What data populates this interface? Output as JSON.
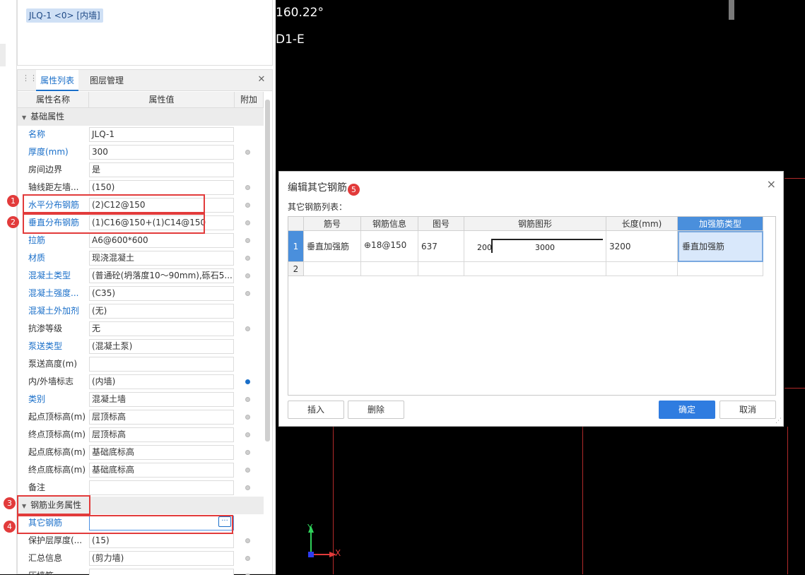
{
  "top_panel": {
    "wall_tag": "JLQ-1 <0> [内墙]"
  },
  "tabs": [
    {
      "label": "属性列表"
    },
    {
      "label": "图层管理"
    }
  ],
  "table_header": {
    "name": "属性名称",
    "value": "属性值",
    "extra": "附加"
  },
  "groups": [
    {
      "label": "基础属性"
    },
    {
      "label": "钢筋业务属性"
    }
  ],
  "props": [
    {
      "name": "名称",
      "value": "JLQ-1"
    },
    {
      "name": "厚度(mm)",
      "value": "300"
    },
    {
      "name": "房间边界",
      "value": "是"
    },
    {
      "name": "轴线距左墙...",
      "value": "(150)"
    },
    {
      "name": "水平分布钢筋",
      "value": "(2)C12@150"
    },
    {
      "name": "垂直分布钢筋",
      "value": "(1)C16@150+(1)C14@150"
    },
    {
      "name": "拉筋",
      "value": "A6@600*600"
    },
    {
      "name": "材质",
      "value": "现浇混凝土"
    },
    {
      "name": "混凝土类型",
      "value": "(普通砼(坍落度10～90mm),砾石5..."
    },
    {
      "name": "混凝土强度...",
      "value": "(C35)"
    },
    {
      "name": "混凝土外加剂",
      "value": "(无)"
    },
    {
      "name": "抗渗等级",
      "value": "无"
    },
    {
      "name": "泵送类型",
      "value": "(混凝土泵)"
    },
    {
      "name": "泵送高度(m)",
      "value": ""
    },
    {
      "name": "内/外墙标志",
      "value": "(内墙)"
    },
    {
      "name": "类别",
      "value": "混凝土墙"
    },
    {
      "name": "起点顶标高(m)",
      "value": "层顶标高"
    },
    {
      "name": "终点顶标高(m)",
      "value": "层顶标高"
    },
    {
      "name": "起点底标高(m)",
      "value": "基础底标高"
    },
    {
      "name": "终点底标高(m)",
      "value": "基础底标高"
    },
    {
      "name": "备注",
      "value": ""
    }
  ],
  "rebar_props": [
    {
      "name": "其它钢筋",
      "value": "",
      "button": "···"
    },
    {
      "name": "保护层厚度(...",
      "value": "(15)"
    },
    {
      "name": "汇总信息",
      "value": "(剪力墙)"
    },
    {
      "name": "压墙筋",
      "value": ""
    }
  ],
  "badges": [
    "1",
    "2",
    "3",
    "4",
    "5"
  ],
  "canvas": {
    "angle_text": "160.22°",
    "axis_label": "D1-E",
    "y_label": "Y",
    "x_label": "X"
  },
  "dialog": {
    "title": "编辑其它钢筋",
    "subtitle": "其它钢筋列表：",
    "close": "×",
    "columns": [
      "筋号",
      "钢筋信息",
      "图号",
      "钢筋图形",
      "长度(mm)",
      "加强筋类型"
    ],
    "rows": [
      {
        "num": "1",
        "bar_no": "垂直加强筋",
        "info": "⊕18@150",
        "fig": "637",
        "shape_left": "200",
        "shape_mid": "3000",
        "length": "3200",
        "type": "垂直加强筋"
      },
      {
        "num": "2",
        "bar_no": "",
        "info": "",
        "fig": "",
        "shape_left": "",
        "shape_mid": "",
        "length": "",
        "type": ""
      }
    ],
    "buttons": {
      "insert": "插入",
      "delete": "删除",
      "ok": "确定",
      "cancel": "取消"
    }
  },
  "colors": {
    "accent": "#1a6fc9",
    "highlight": "#e23b3b",
    "selection": "#4a8fdc"
  }
}
